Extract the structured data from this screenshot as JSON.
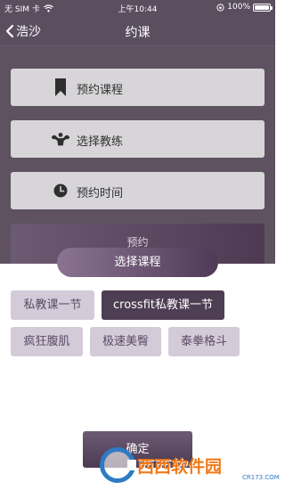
{
  "status_bar": {
    "carrier": "无 SIM 卡",
    "time": "上午10:44",
    "battery": "100%"
  },
  "nav": {
    "back_label": "浩沙",
    "title": "约课"
  },
  "options": [
    {
      "label": "预约课程",
      "icon": "bookmark-icon"
    },
    {
      "label": "选择教练",
      "icon": "muscle-icon"
    },
    {
      "label": "预约时间",
      "icon": "clock-icon"
    }
  ],
  "submit_label": "预约",
  "sheet": {
    "title": "选择课程",
    "chips": [
      {
        "label": "私教课一节",
        "selected": false
      },
      {
        "label": "crossfit私教课一节",
        "selected": true
      },
      {
        "label": "疯狂腹肌",
        "selected": false
      },
      {
        "label": "极速美臀",
        "selected": false
      },
      {
        "label": "泰拳格斗",
        "selected": false
      }
    ],
    "confirm_label": "确定"
  },
  "watermark": {
    "brand": "西西软件园",
    "url": "CR173.COM"
  },
  "colors": {
    "overlay_bg": "#5e5261",
    "accent": "#4d3e53",
    "chip_bg": "#d4cbd9",
    "chip_text": "#5b4a63"
  }
}
